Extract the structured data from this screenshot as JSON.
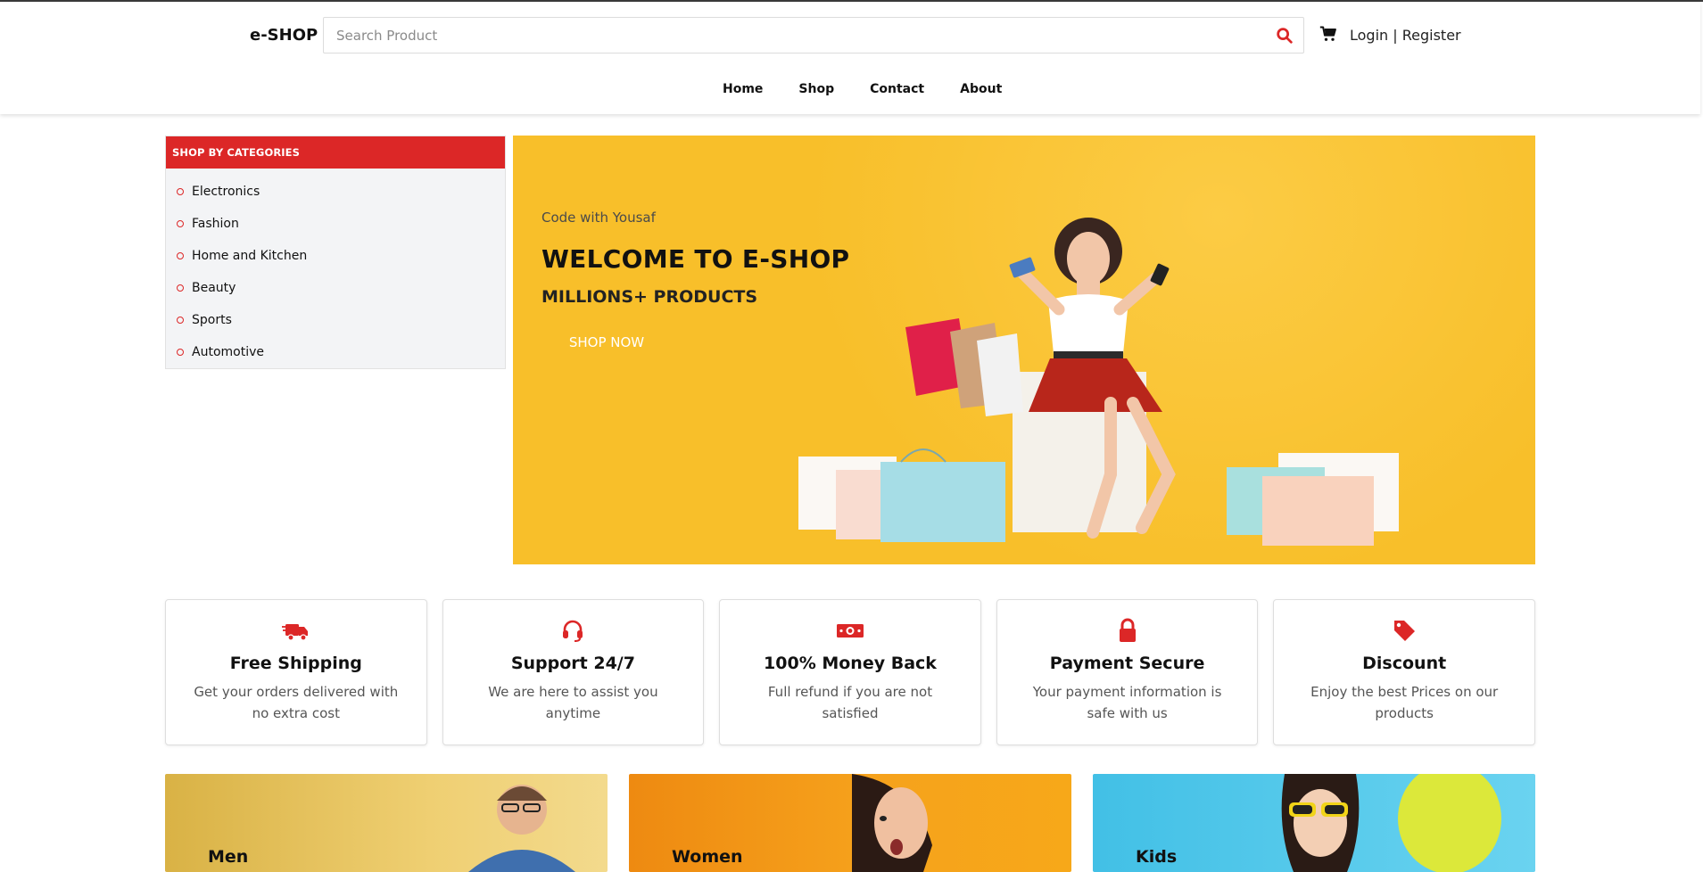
{
  "header": {
    "logo": "e-SHOP",
    "search_placeholder": "Search Product",
    "login": "Login",
    "separator": "|",
    "register": "Register"
  },
  "nav": {
    "items": [
      "Home",
      "Shop",
      "Contact",
      "About"
    ]
  },
  "categories": {
    "title": "SHOP BY CATEGORIES",
    "items": [
      "Electronics",
      "Fashion",
      "Home and Kitchen",
      "Beauty",
      "Sports",
      "Automotive"
    ]
  },
  "hero": {
    "tagline": "Code with Yousaf",
    "title": "WELCOME TO E-SHOP",
    "subtitle": "MILLIONS+ PRODUCTS",
    "button": "SHOP NOW"
  },
  "features": [
    {
      "icon": "truck-icon",
      "title": "Free Shipping",
      "text": "Get your orders delivered with no extra cost"
    },
    {
      "icon": "headset-icon",
      "title": "Support 24/7",
      "text": "We are here to assist you anytime"
    },
    {
      "icon": "money-bill-icon",
      "title": "100% Money Back",
      "text": "Full refund if you are not satisfied"
    },
    {
      "icon": "lock-icon",
      "title": "Payment Secure",
      "text": "Your payment information is safe with us"
    },
    {
      "icon": "tag-icon",
      "title": "Discount",
      "text": "Enjoy the best Prices on our products"
    }
  ],
  "banners": [
    "Men",
    "Women",
    "Kids"
  ],
  "colors": {
    "accent": "#dc2727",
    "hero_bg": "#f8bf2a"
  }
}
